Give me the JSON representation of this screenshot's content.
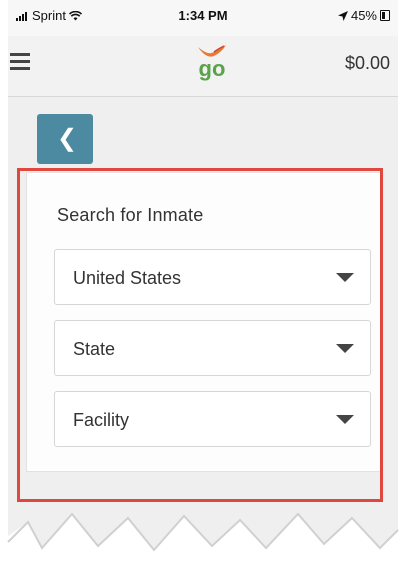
{
  "status_bar": {
    "carrier": "Sprint",
    "time": "1:34 PM",
    "battery": "45%"
  },
  "header": {
    "logo_text": "go",
    "balance": "$0.00"
  },
  "icons": {
    "menu": "hamburger-menu-icon",
    "back": "chevron-left-icon",
    "dropdown": "caret-down-icon",
    "signal": "signal-bars-icon",
    "wifi": "wifi-icon",
    "location": "location-arrow-icon",
    "battery": "battery-icon"
  },
  "search": {
    "title": "Search for Inmate",
    "country": {
      "value": "United States"
    },
    "state": {
      "value": "State"
    },
    "facility": {
      "value": "Facility"
    }
  },
  "colors": {
    "back_button": "#4b8aa0",
    "highlight": "#e0483f",
    "logo_green": "#5aa34a",
    "logo_orange": "#e97a33"
  }
}
